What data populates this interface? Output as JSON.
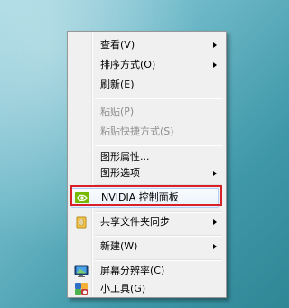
{
  "menu": {
    "items": [
      {
        "label": "查看(V)",
        "submenu": true,
        "disabled": false
      },
      {
        "label": "排序方式(O)",
        "submenu": true,
        "disabled": false
      },
      {
        "label": "刷新(E)",
        "submenu": false,
        "disabled": false
      },
      {
        "label": "粘贴(P)",
        "submenu": false,
        "disabled": true
      },
      {
        "label": "粘贴快捷方式(S)",
        "submenu": false,
        "disabled": true
      },
      {
        "label": "图形属性...",
        "submenu": false,
        "disabled": false
      },
      {
        "label": "图形选项",
        "submenu": true,
        "disabled": false
      },
      {
        "label": "NVIDIA 控制面板",
        "submenu": false,
        "disabled": false,
        "icon": "nvidia-logo-icon",
        "highlighted": true
      },
      {
        "label": "共享文件夹同步",
        "submenu": true,
        "disabled": false,
        "icon": "sync-folder-icon"
      },
      {
        "label": "新建(W)",
        "submenu": true,
        "disabled": false
      },
      {
        "label": "屏幕分辨率(C)",
        "submenu": false,
        "disabled": false,
        "icon": "screen-resolution-icon"
      },
      {
        "label": "小工具(G)",
        "submenu": false,
        "disabled": false,
        "icon": "gadgets-icon"
      }
    ]
  },
  "colors": {
    "highlight_border": "#d82028",
    "menu_bg": "#f0f0f0",
    "nvidia_green": "#76b900"
  }
}
